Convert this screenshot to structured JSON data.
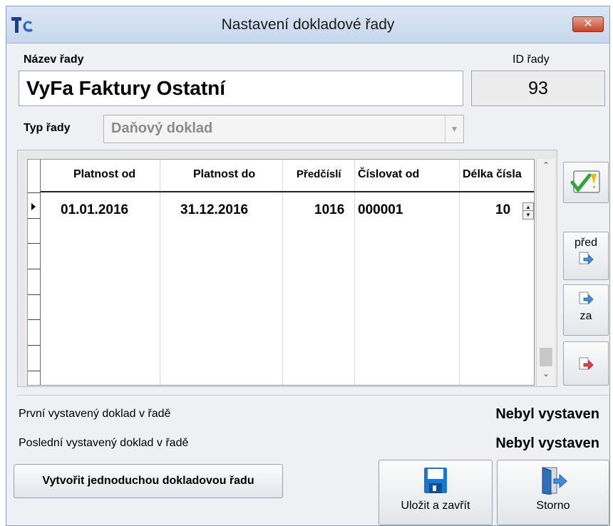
{
  "window": {
    "title": "Nastavení dokladové řady",
    "logo_text": "Tc",
    "close_glyph": "✕"
  },
  "form": {
    "name_label": "Název řady",
    "name_value": "VyFa Faktury Ostatní",
    "id_label": "ID řady",
    "id_value": "93",
    "type_label": "Typ řady",
    "type_value": "Daňový doklad"
  },
  "grid": {
    "columns": [
      "Platnost od",
      "Platnost do",
      "Předčíslí",
      "Číslovat od",
      "Délka čísla"
    ],
    "rows": [
      {
        "valid_from": "01.01.2016",
        "valid_to": "31.12.2016",
        "prefix": "1016",
        "start_number": "000001",
        "length": "10"
      }
    ]
  },
  "side_buttons": {
    "before_label": "před",
    "after_label": "za"
  },
  "info": {
    "first_label": "První vystavený doklad v řadě",
    "first_value": "Nebyl vystaven",
    "last_label": "Poslední vystavený doklad v řadě",
    "last_value": "Nebyl vystaven"
  },
  "actions": {
    "create_simple_label": "Vytvořit jednoduchou dokladovou řadu",
    "save_close_label": "Uložit a zavřít",
    "cancel_label": "Storno"
  },
  "icons": {
    "validate": "check-warning-icon",
    "insert_before": "insert-before-icon",
    "insert_after": "insert-after-icon",
    "delete": "delete-row-icon",
    "save": "floppy-disk-icon",
    "cancel": "exit-door-icon"
  },
  "colors": {
    "title_bar": "#c7d7ec",
    "close_button": "#c8452c",
    "accent_blue": "#2d69c4",
    "check_green": "#2fa53a"
  }
}
